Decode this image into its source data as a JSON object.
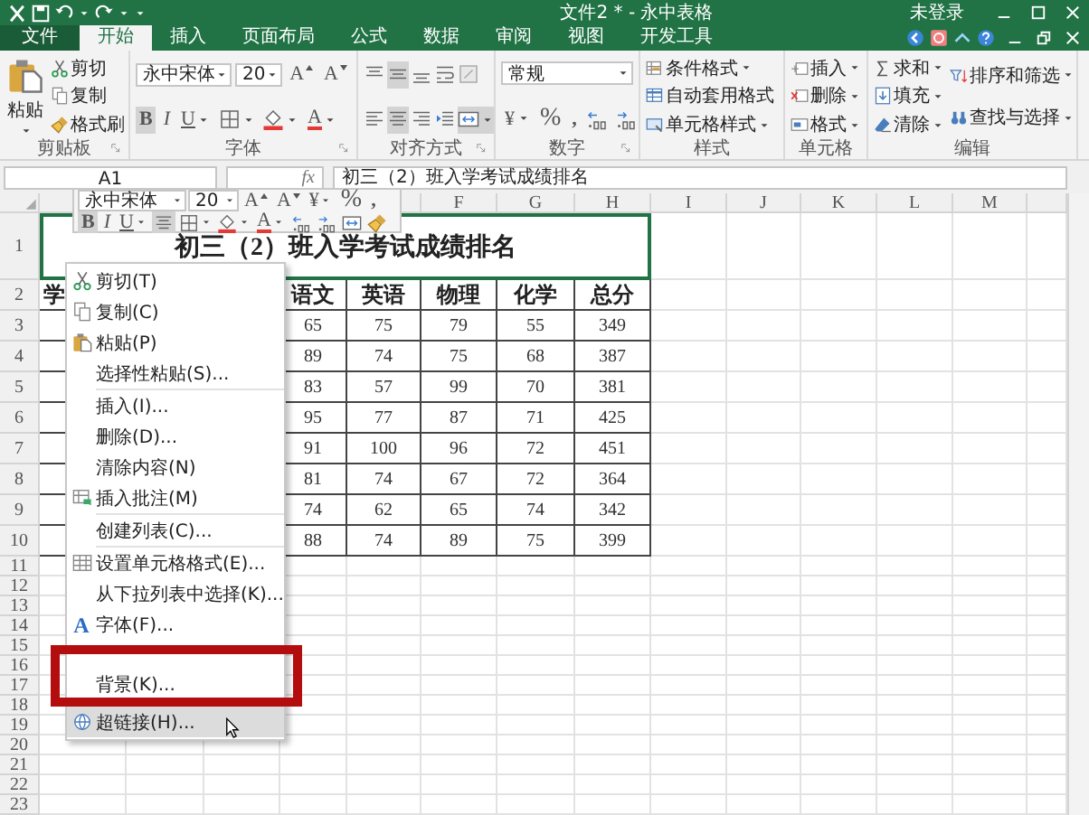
{
  "window": {
    "title": "文件2 * - 永中表格",
    "user": "未登录"
  },
  "tabs": [
    {
      "kind": "file",
      "label": "文件",
      "selected": false
    },
    {
      "kind": "tab",
      "label": "开始",
      "selected": true
    },
    {
      "kind": "tab",
      "label": "插入",
      "selected": false
    },
    {
      "kind": "tab",
      "label": "页面布局",
      "selected": false
    },
    {
      "kind": "tab",
      "label": "公式",
      "selected": false
    },
    {
      "kind": "tab",
      "label": "数据",
      "selected": false
    },
    {
      "kind": "tab",
      "label": "审阅",
      "selected": false
    },
    {
      "kind": "tab",
      "label": "视图",
      "selected": false
    },
    {
      "kind": "tab",
      "label": "开发工具",
      "selected": false
    }
  ],
  "ribbon": [
    {
      "label": "剪贴板",
      "launcher": true,
      "lines": [
        [
          {
            "kind": "paste",
            "label": "粘贴",
            "dropdown": true
          }
        ],
        [
          {
            "kind": "cut",
            "label": "剪切",
            "dropdown": false
          },
          {
            "kind": "copy",
            "label": "复制",
            "dropdown": false
          },
          {
            "kind": "format-painter",
            "label": "格式刷",
            "dropdown": false
          }
        ]
      ]
    },
    {
      "label": "字体",
      "launcher": true,
      "lines": [
        [
          {
            "kind": "font-name",
            "value": "永中宋体",
            "dropdown": true
          },
          {
            "kind": "font-size",
            "value": "20",
            "dropdown": true
          },
          {
            "kind": "grow-font",
            "text": "A",
            "dropdown": false,
            "pressed": false
          },
          {
            "kind": "shrink-font",
            "text": "A",
            "dropdown": false,
            "pressed": false
          }
        ],
        [
          {
            "kind": "bold",
            "text": "B",
            "dropdown": false,
            "pressed": true
          },
          {
            "kind": "italic",
            "text": "I",
            "dropdown": false,
            "pressed": false
          },
          {
            "kind": "underline",
            "text": "U",
            "dropdown": true,
            "pressed": false
          },
          {
            "kind": "borders",
            "dropdown": true,
            "pressed": false
          },
          {
            "kind": "fill-color",
            "dropdown": true,
            "pressed": false
          },
          {
            "kind": "font-color",
            "text": "A",
            "dropdown": true,
            "pressed": false
          }
        ]
      ]
    },
    {
      "label": "对齐方式",
      "launcher": true,
      "lines": [
        [
          {
            "kind": "align-top",
            "dropdown": false,
            "pressed": false
          },
          {
            "kind": "align-middle",
            "dropdown": false,
            "pressed": true
          },
          {
            "kind": "align-bottom",
            "dropdown": false,
            "pressed": false
          },
          {
            "kind": "wrap-text",
            "dropdown": false,
            "pressed": false
          },
          {
            "kind": "text-direction",
            "dropdown": false,
            "pressed": false
          }
        ],
        [
          {
            "kind": "align-left",
            "dropdown": false,
            "pressed": false
          },
          {
            "kind": "align-center",
            "dropdown": false,
            "pressed": true
          },
          {
            "kind": "align-right",
            "dropdown": false,
            "pressed": false
          },
          {
            "kind": "indent",
            "dropdown": false,
            "pressed": false
          },
          {
            "kind": "merge",
            "dropdown": true,
            "pressed": true
          }
        ]
      ]
    },
    {
      "label": "数字",
      "launcher": true,
      "lines": [
        [
          {
            "kind": "number-format",
            "value": "常规",
            "dropdown": true
          }
        ],
        [
          {
            "kind": "currency",
            "text": "¥",
            "dropdown": true,
            "pressed": false
          },
          {
            "kind": "percent",
            "text": "%",
            "dropdown": false,
            "pressed": false
          },
          {
            "kind": "comma",
            "text": ",",
            "dropdown": false,
            "pressed": false
          },
          {
            "kind": "increase-decimal",
            "dropdown": false,
            "pressed": false
          },
          {
            "kind": "decrease-decimal",
            "dropdown": false,
            "pressed": false
          }
        ]
      ]
    },
    {
      "label": "样式",
      "launcher": false,
      "lines": [
        [
          {
            "kind": "conditional-format",
            "label": "条件格式",
            "dropdown": true
          },
          {
            "kind": "table-format",
            "label": "自动套用格式",
            "dropdown": false
          },
          {
            "kind": "cell-style",
            "label": "单元格样式",
            "dropdown": true
          }
        ]
      ]
    },
    {
      "label": "单元格",
      "launcher": false,
      "lines": [
        [
          {
            "kind": "insert",
            "label": "插入",
            "dropdown": true
          },
          {
            "kind": "delete",
            "label": "删除",
            "dropdown": true
          },
          {
            "kind": "format",
            "label": "格式",
            "dropdown": true
          }
        ]
      ]
    },
    {
      "label": "编辑",
      "launcher": false,
      "lines": [
        [
          {
            "kind": "sum",
            "label": "求和",
            "dropdown": true
          },
          {
            "kind": "fill",
            "label": "填充",
            "dropdown": true
          },
          {
            "kind": "clear",
            "label": "清除",
            "dropdown": true
          }
        ],
        [
          {
            "kind": "sort-filter",
            "label": "排序和筛选",
            "dropdown": true
          },
          {
            "kind": "find-select",
            "label": "查找与选择",
            "dropdown": true
          }
        ]
      ]
    }
  ],
  "formula_bar": {
    "name_box": "A1",
    "function_label": "fx",
    "content": "初三（2）班入学考试成绩排名"
  },
  "mini_toolbar": {
    "lines": [
      [
        {
          "kind": "font-name",
          "value": "永中宋体",
          "dropdown": true
        },
        {
          "kind": "font-size",
          "value": "20",
          "dropdown": true
        },
        {
          "kind": "grow-font",
          "text": "A",
          "dropdown": false,
          "pressed": false
        },
        {
          "kind": "shrink-font",
          "text": "A",
          "dropdown": false,
          "pressed": false
        },
        {
          "kind": "currency",
          "text": "¥",
          "dropdown": true,
          "pressed": false
        },
        {
          "kind": "percent",
          "text": "%",
          "dropdown": false,
          "pressed": false
        },
        {
          "kind": "comma",
          "text": ",",
          "dropdown": false,
          "pressed": false
        }
      ],
      [
        {
          "kind": "bold",
          "text": "B",
          "dropdown": false,
          "pressed": true
        },
        {
          "kind": "italic",
          "text": "I",
          "dropdown": false,
          "pressed": false
        },
        {
          "kind": "underline",
          "text": "U",
          "dropdown": true,
          "pressed": false
        },
        {
          "kind": "align-center",
          "dropdown": false,
          "pressed": true
        },
        {
          "kind": "borders",
          "dropdown": true,
          "pressed": false
        },
        {
          "kind": "fill-color",
          "dropdown": true,
          "pressed": false
        },
        {
          "kind": "font-color",
          "text": "A",
          "dropdown": true,
          "pressed": false
        },
        {
          "kind": "increase-decimal",
          "dropdown": false,
          "pressed": false
        },
        {
          "kind": "decrease-decimal",
          "dropdown": false,
          "pressed": false
        },
        {
          "kind": "merge",
          "dropdown": false,
          "pressed": false
        },
        {
          "kind": "painter-tool",
          "dropdown": false,
          "pressed": false
        }
      ]
    ]
  },
  "sheet": {
    "column_headers": [
      "F",
      "G",
      "H",
      "I",
      "J",
      "K",
      "L",
      "M"
    ],
    "row_headers": [
      "1",
      "2",
      "3",
      "4",
      "5",
      "6",
      "7",
      "8",
      "9",
      "10",
      "11",
      "12",
      "13",
      "14",
      "15",
      "16",
      "17",
      "18",
      "19",
      "20",
      "21",
      "22",
      "23"
    ],
    "title": "初三（2）班入学考试成绩排名",
    "rows": [
      {
        "label": "学",
        "values": [
          "语文",
          "英语",
          "物理",
          "化学",
          "总分"
        ]
      },
      {
        "values": [
          "65",
          "75",
          "79",
          "55",
          "349"
        ]
      },
      {
        "values": [
          "89",
          "74",
          "75",
          "68",
          "387"
        ]
      },
      {
        "values": [
          "83",
          "57",
          "99",
          "70",
          "381"
        ]
      },
      {
        "values": [
          "95",
          "77",
          "87",
          "71",
          "425"
        ]
      },
      {
        "values": [
          "91",
          "100",
          "96",
          "72",
          "451"
        ]
      },
      {
        "values": [
          "81",
          "74",
          "67",
          "72",
          "364"
        ]
      },
      {
        "values": [
          "74",
          "62",
          "65",
          "74",
          "342"
        ]
      },
      {
        "values": [
          "88",
          "74",
          "89",
          "75",
          "399"
        ]
      }
    ]
  },
  "context_menu": [
    {
      "kind": "cut",
      "label": "剪切(T)",
      "highlighted": false
    },
    {
      "kind": "copy",
      "label": "复制(C)",
      "highlighted": false
    },
    {
      "kind": "paste",
      "label": "粘贴(P)",
      "highlighted": false
    },
    {
      "kind": "plain",
      "label": "选择性粘贴(S)...",
      "highlighted": false
    },
    {
      "kind": "separator"
    },
    {
      "kind": "plain",
      "label": "插入(I)...",
      "highlighted": false
    },
    {
      "kind": "plain",
      "label": "删除(D)...",
      "highlighted": false
    },
    {
      "kind": "plain",
      "label": "清除内容(N)",
      "highlighted": false
    },
    {
      "kind": "comment",
      "label": "插入批注(M)",
      "highlighted": false
    },
    {
      "kind": "separator"
    },
    {
      "kind": "plain",
      "label": "创建列表(C)...",
      "highlighted": false
    },
    {
      "kind": "separator"
    },
    {
      "kind": "cell-format",
      "label": "设置单元格格式(E)...",
      "highlighted": false
    },
    {
      "kind": "plain",
      "label": "从下拉列表中选择(K)...",
      "highlighted": false
    },
    {
      "kind": "font",
      "glyph": "A",
      "label": "字体(F)...",
      "highlighted": false
    },
    {
      "kind": "hidden"
    },
    {
      "kind": "plain",
      "label": "背景(K)...",
      "highlighted": false
    },
    {
      "kind": "hyperlink",
      "label": "超链接(H)...",
      "highlighted": true
    }
  ]
}
